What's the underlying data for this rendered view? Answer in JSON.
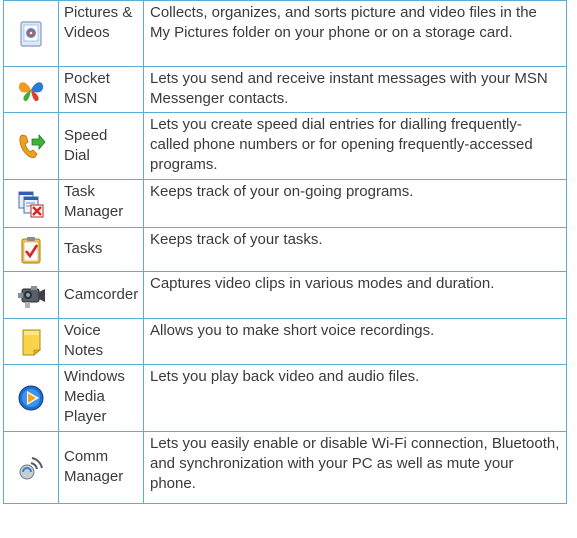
{
  "rows": [
    {
      "icon": "pictures-videos-icon",
      "name": "Pictures & Videos",
      "description": "Collects, organizes, and sorts picture and video files in the My Pictures folder on your phone or on a storage card."
    },
    {
      "icon": "pocket-msn-butterfly-icon",
      "name": "Pocket MSN",
      "description": "Lets you send and receive instant messages with your MSN Messenger contacts."
    },
    {
      "icon": "speed-dial-phone-icon",
      "name": "Speed Dial",
      "description": "Lets you create speed dial entries for dialling frequently-called phone numbers or for opening frequently-accessed programs."
    },
    {
      "icon": "task-manager-icon",
      "name": "Task Manager",
      "description": "Keeps track of your on-going programs."
    },
    {
      "icon": "tasks-clipboard-icon",
      "name": "Tasks",
      "description": "Keeps track of your tasks."
    },
    {
      "icon": "camcorder-icon",
      "name": "Camcorder",
      "description": "Captures video clips in various modes and duration."
    },
    {
      "icon": "voice-notes-icon",
      "name": "Voice Notes",
      "description": "Allows you to make short voice recordings."
    },
    {
      "icon": "windows-media-player-icon",
      "name": "Windows Media Player",
      "description": "Lets you play back video and audio files."
    },
    {
      "icon": "comm-manager-icon",
      "name": "Comm Manager",
      "description": "Lets you easily enable or disable Wi-Fi connection, Bluetooth, and synchronization with your PC as well as mute your phone."
    }
  ]
}
